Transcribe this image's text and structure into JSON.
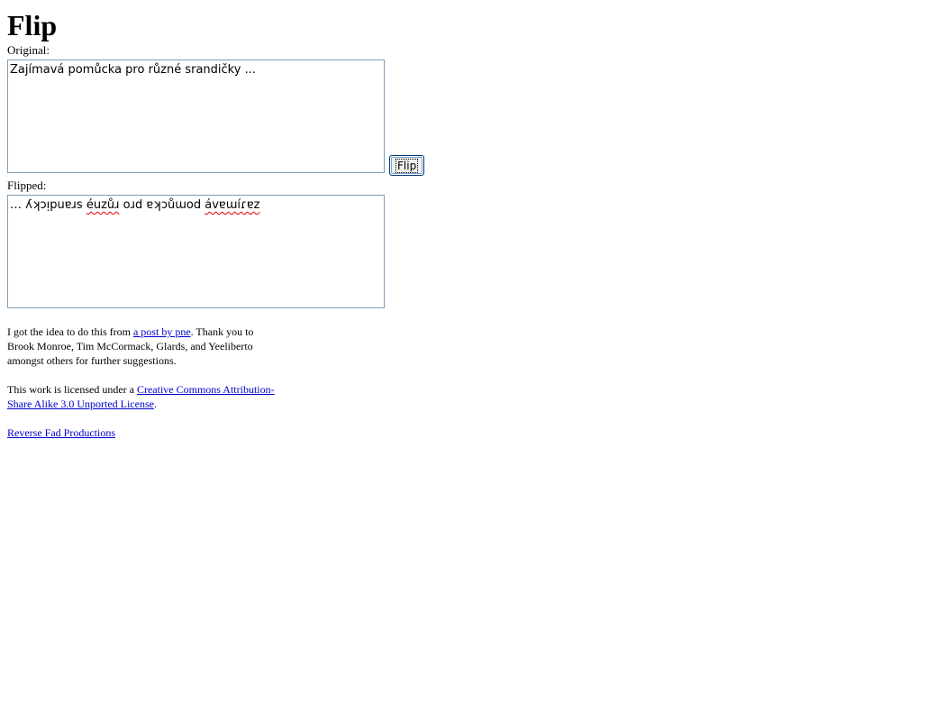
{
  "page": {
    "title": "Flip"
  },
  "original": {
    "label": "Original:",
    "value": "Zajímavá pomůcka pro různé srandičky ..."
  },
  "flip_button": {
    "label": "Flip"
  },
  "flipped": {
    "label": "Flipped:",
    "segments": [
      {
        "text": "… ʎʞɔᴉpuɐɹs ",
        "misspelled": false
      },
      {
        "text": "éuzůɹ",
        "misspelled": true
      },
      {
        "text": " oɹd ɐʞɔůɯod ",
        "misspelled": false
      },
      {
        "text": "ávɐɯíɾɐz",
        "misspelled": true
      }
    ]
  },
  "credits": {
    "idea_prefix": "I got the idea to do this from ",
    "idea_link": "a post by pne",
    "idea_suffix": ". Thank you to Brook Monroe, Tim McCormack, Glards, and Yeeliberto amongst others for further suggestions.",
    "license_prefix": "This work is licensed under a ",
    "license_link": "Creative Commons Attribution-Share Alike 3.0 Unported License",
    "license_suffix": ".",
    "footer_link": "Reverse Fad Productions"
  }
}
